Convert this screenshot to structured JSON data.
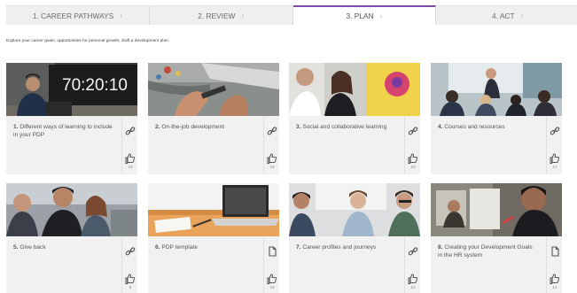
{
  "tabs": [
    {
      "label": "1. CAREER PATHWAYS",
      "active": false
    },
    {
      "label": "2. REVIEW",
      "active": false
    },
    {
      "label": "3. PLAN",
      "active": true
    },
    {
      "label": "4. ACT",
      "active": false
    }
  ],
  "intro": "Explore your career goals, opportunities for personal growth, draft a development plan.",
  "chevron": "›",
  "cards": [
    {
      "num": "1.",
      "title": " Different ways of learning to include in your PDP",
      "icon": "link-icon",
      "count": "23",
      "thumb_text": "70:20:10"
    },
    {
      "num": "2.",
      "title": " On-the-job development",
      "icon": "link-icon",
      "count": "19"
    },
    {
      "num": "3.",
      "title": " Social and collaborative learning",
      "icon": "link-icon",
      "count": "16"
    },
    {
      "num": "4.",
      "title": " Courses and resources",
      "icon": "link-icon",
      "count": "17"
    },
    {
      "num": "5.",
      "title": " Give back",
      "icon": "link-icon",
      "count": "9"
    },
    {
      "num": "6.",
      "title": " PDP template",
      "icon": "document-icon",
      "count": "16"
    },
    {
      "num": "7.",
      "title": " Career profiles and journeys",
      "icon": "link-icon",
      "count": "12"
    },
    {
      "num": "8.",
      "title": " Creating your Development Goals in the HR system",
      "icon": "document-icon",
      "count": "14"
    }
  ],
  "colors": {
    "accent": "#7b4ca6",
    "card_bg": "#f1f1f1",
    "tab_bg": "#efefef"
  }
}
